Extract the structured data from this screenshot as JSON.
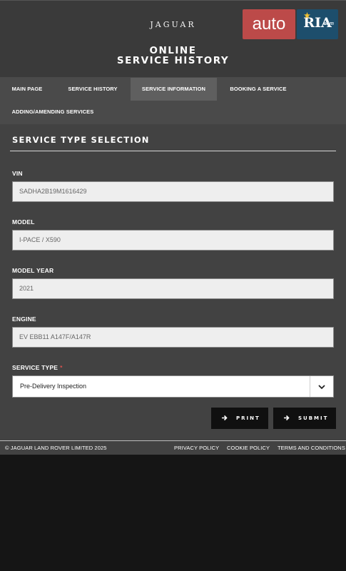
{
  "header": {
    "brand": "JAGUAR",
    "title_line1": "ONLINE",
    "title_line2": "SERVICE HISTORY"
  },
  "watermark": {
    "part1": "auto",
    "part2": "RIA",
    "part3": ".com"
  },
  "nav": {
    "items": [
      {
        "label": "MAIN PAGE",
        "active": false
      },
      {
        "label": "SERVICE HISTORY",
        "active": false
      },
      {
        "label": "SERVICE INFORMATION",
        "active": true
      },
      {
        "label": "BOOKING A SERVICE",
        "active": false
      },
      {
        "label": "ADDING/AMENDING SERVICES",
        "active": false
      }
    ]
  },
  "form": {
    "title": "SERVICE TYPE SELECTION",
    "fields": [
      {
        "label": "VIN",
        "value": "SADHA2B19M1616429"
      },
      {
        "label": "MODEL",
        "value": "I-PACE / X590"
      },
      {
        "label": "MODEL YEAR",
        "value": "2021"
      },
      {
        "label": "ENGINE",
        "value": "EV EBB11 A147F/A147R"
      }
    ],
    "service_type": {
      "label": "SERVICE TYPE",
      "required_mark": "*",
      "selected": "Pre-Delivery Inspection"
    },
    "buttons": {
      "print": "PRINT",
      "submit": "SUBMIT"
    }
  },
  "footer": {
    "copyright": "© JAGUAR LAND ROVER LIMITED 2025",
    "links": [
      "PRIVACY POLICY",
      "COOKIE POLICY",
      "TERMS AND CONDITIONS"
    ]
  },
  "icons": {
    "chevron": "chevron-down-icon",
    "arrow": "arrow-right-icon"
  }
}
